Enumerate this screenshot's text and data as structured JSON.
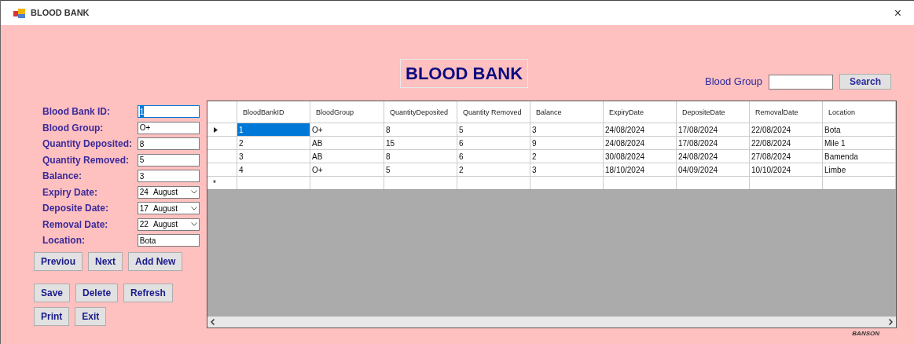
{
  "window": {
    "title": "BLOOD BANK",
    "close": "×"
  },
  "heading": "BLOOD BANK",
  "search": {
    "label": "Blood Group",
    "button": "Search"
  },
  "fields": [
    {
      "label": "Blood Bank ID:",
      "kind": "text",
      "value": "1",
      "focused": true
    },
    {
      "label": "Blood Group:",
      "kind": "text",
      "value": "O+",
      "focused": false
    },
    {
      "label": "Quantity Deposited:",
      "kind": "text",
      "value": "8",
      "focused": false
    },
    {
      "label": "Quantity Removed:",
      "kind": "text",
      "value": "5",
      "focused": false
    },
    {
      "label": "Balance:",
      "kind": "text",
      "value": "3",
      "focused": false
    },
    {
      "label": "Expiry Date:",
      "kind": "date",
      "day": "24",
      "month": "August",
      "focused": false
    },
    {
      "label": "Deposite Date:",
      "kind": "date",
      "day": "17",
      "month": "August",
      "focused": false
    },
    {
      "label": "Removal Date:",
      "kind": "date",
      "day": "22",
      "month": "August",
      "focused": false
    },
    {
      "label": "Location:",
      "kind": "text",
      "value": "Bota",
      "focused": false
    }
  ],
  "button_rows": [
    [
      "Previou",
      "Next",
      "Add New"
    ],
    [
      "Save",
      "Delete",
      "Refresh"
    ],
    [
      "Print",
      "Exit"
    ]
  ],
  "table": {
    "columns": [
      "BloodBankID",
      "BloodGroup",
      "QuantityDeposited",
      "Quantity Removed",
      "Balance",
      "ExpiryDate",
      "DepositeDate",
      "RemovalDate",
      "Location"
    ],
    "rows": [
      {
        "selected": true,
        "cells": [
          "1",
          "O+",
          "8",
          "5",
          "3",
          "24/08/2024",
          "17/08/2024",
          "22/08/2024",
          "Bota"
        ]
      },
      {
        "selected": false,
        "cells": [
          "2",
          "AB",
          "15",
          "6",
          "9",
          "24/08/2024",
          "17/08/2024",
          "22/08/2024",
          "Mile 1"
        ]
      },
      {
        "selected": false,
        "cells": [
          "3",
          "AB",
          "8",
          "6",
          "2",
          "30/08/2024",
          "24/08/2024",
          "27/08/2024",
          "Bamenda"
        ]
      },
      {
        "selected": false,
        "cells": [
          "4",
          "O+",
          "5",
          "2",
          "3",
          "18/10/2024",
          "04/09/2024",
          "10/10/2024",
          "Limbe"
        ]
      }
    ],
    "new_row_marker": "*"
  },
  "footer_text": "BANSON"
}
